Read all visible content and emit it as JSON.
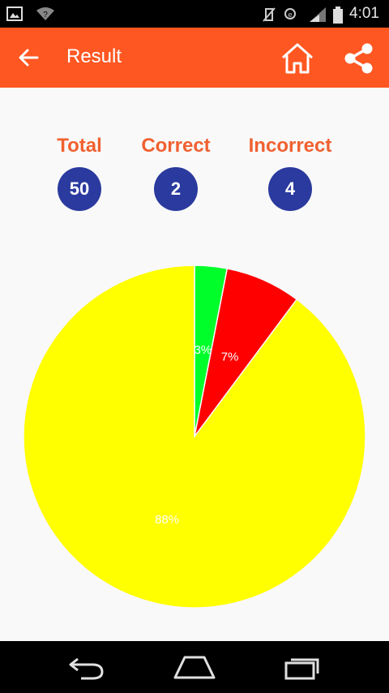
{
  "status_bar": {
    "time": "4:01"
  },
  "app_bar": {
    "title": "Result",
    "back_icon": "arrow-left-icon",
    "home_icon": "home-icon",
    "share_icon": "share-icon"
  },
  "stats": {
    "total": {
      "label": "Total",
      "value": "50"
    },
    "correct": {
      "label": "Correct",
      "value": "2"
    },
    "incorrect": {
      "label": "Incorrect",
      "value": "4"
    }
  },
  "colors": {
    "app_bar": "#ff5722",
    "stat_label": "#f06030",
    "stat_circle": "#2b3a9e"
  },
  "chart_data": {
    "type": "pie",
    "values": [
      3,
      7,
      88
    ],
    "labels": [
      "3%",
      "7%",
      "88%"
    ],
    "colors": [
      "#00ff2a",
      "#ff0000",
      "#ffff00"
    ]
  },
  "nav_bar": {
    "icons": [
      "back-icon",
      "home-icon",
      "recents-icon"
    ]
  }
}
